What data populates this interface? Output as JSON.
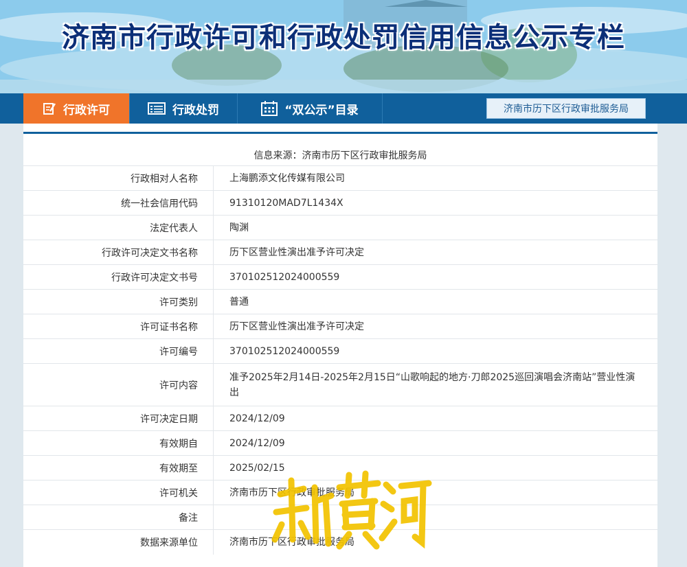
{
  "banner": {
    "title": "济南市行政许可和行政处罚信用信息公示专栏"
  },
  "nav": {
    "tabs": [
      {
        "label": "行政许可",
        "icon": "edit-document-icon",
        "active": true
      },
      {
        "label": "行政处罚",
        "icon": "list-icon",
        "active": false
      },
      {
        "label": "“双公示”目录",
        "icon": "calendar-icon",
        "active": false
      }
    ],
    "org_label": "济南市历下区行政审批服务局"
  },
  "colors": {
    "nav": "#10609c",
    "active_tab": "#f0742a",
    "title": "#0c2f78",
    "watermark": "#f2c300"
  },
  "detail": {
    "source": "信息来源：济南市历下区行政审批服务局",
    "rows": [
      {
        "label": "行政相对人名称",
        "value": "上海鹏添文化传媒有限公司"
      },
      {
        "label": "统一社会信用代码",
        "value": "91310120MAD7L1434X"
      },
      {
        "label": "法定代表人",
        "value": "陶渊"
      },
      {
        "label": "行政许可决定文书名称",
        "value": "历下区营业性演出准予许可决定"
      },
      {
        "label": "行政许可决定文书号",
        "value": "370102512024000559"
      },
      {
        "label": "许可类别",
        "value": "普通"
      },
      {
        "label": "许可证书名称",
        "value": "历下区营业性演出准予许可决定"
      },
      {
        "label": "许可编号",
        "value": "370102512024000559"
      },
      {
        "label": "许可内容",
        "value": "准予2025年2月14日-2025年2月15日“山歌响起的地方·刀郎2025巡回演唱会济南站”营业性演出"
      },
      {
        "label": "许可决定日期",
        "value": "2024/12/09"
      },
      {
        "label": "有效期自",
        "value": "2024/12/09"
      },
      {
        "label": "有效期至",
        "value": "2025/02/15"
      },
      {
        "label": "许可机关",
        "value": "济南市历下区行政审批服务局"
      },
      {
        "label": "备注",
        "value": ""
      },
      {
        "label": "数据来源单位",
        "value": "济南市历下区行政审批服务局"
      }
    ]
  },
  "watermark": {
    "text": "新黄河"
  }
}
